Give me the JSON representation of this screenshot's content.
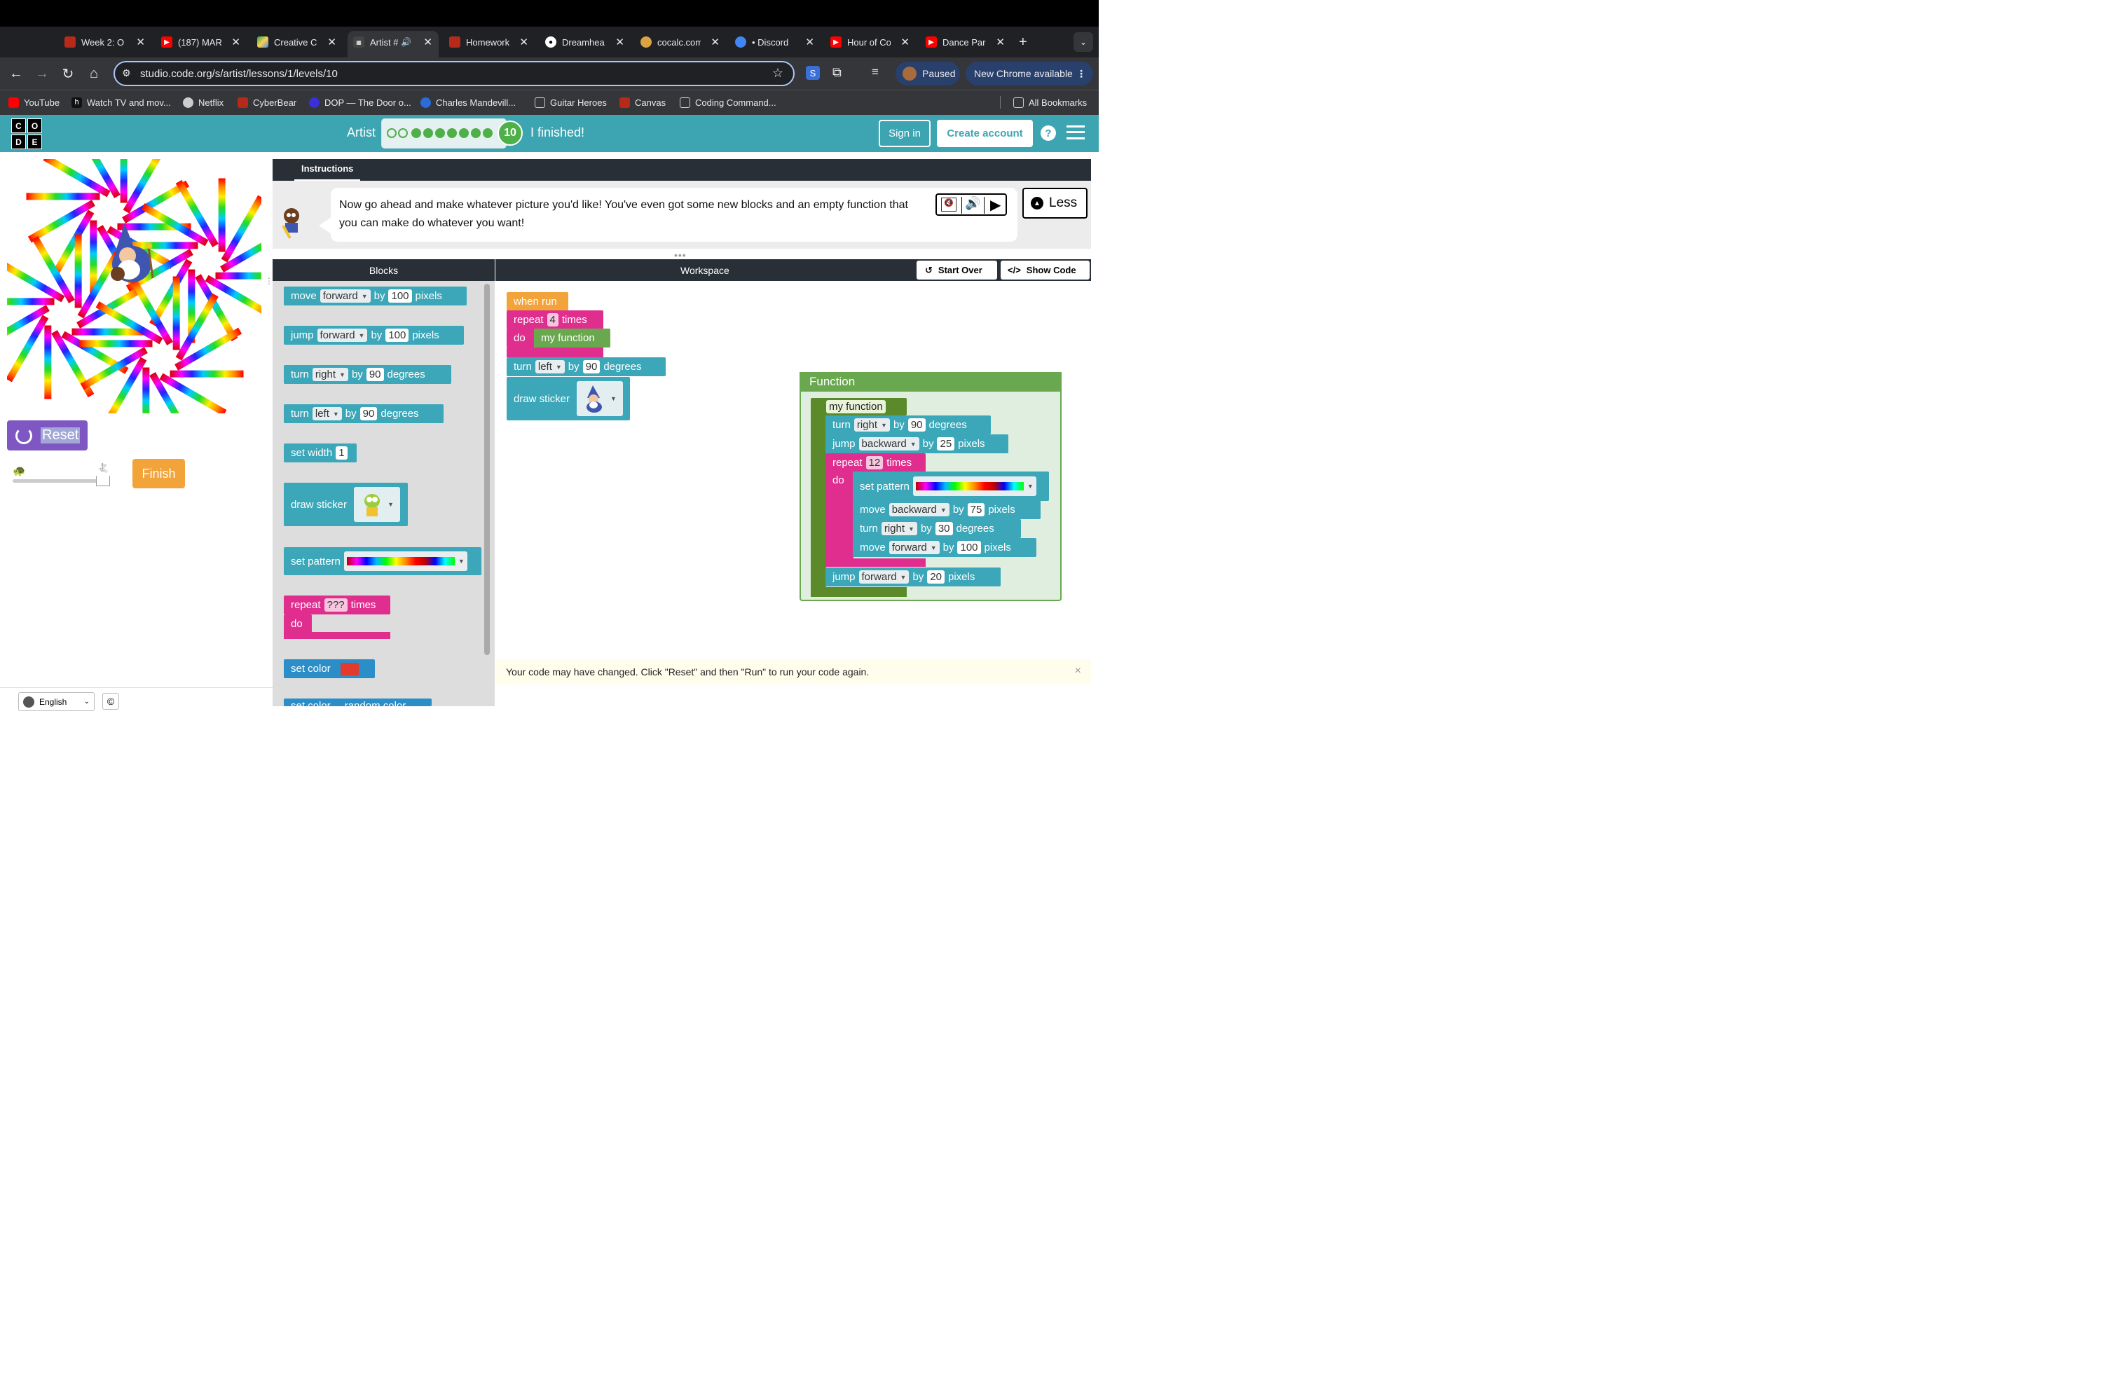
{
  "browser": {
    "tabs": [
      {
        "title": "Week 2: O",
        "icon": "canvas-icon",
        "color": "#b52a1a"
      },
      {
        "title": "(187) MAR",
        "icon": "youtube-icon",
        "color": "#ff0000"
      },
      {
        "title": "Creative C",
        "icon": "google-drive-icon",
        "color": "#1fa463"
      },
      {
        "title": "Artist #",
        "icon": "code-org-icon",
        "color": "#444444"
      },
      {
        "title": "Homework",
        "icon": "canvas-icon",
        "color": "#b52a1a"
      },
      {
        "title": "Dreamhea",
        "icon": "github-icon",
        "color": "#ffffff"
      },
      {
        "title": "cocalc.com",
        "icon": "cocalc-icon",
        "color": "#d9a441"
      },
      {
        "title": "• Discord",
        "icon": "chrome-icon",
        "color": "#4285f4"
      },
      {
        "title": "Hour of Co",
        "icon": "youtube-icon",
        "color": "#ff0000"
      },
      {
        "title": "Dance Par",
        "icon": "youtube-icon",
        "color": "#ff0000"
      }
    ],
    "url": "studio.code.org/s/artist/lessons/1/levels/10",
    "profile_label": "Paused",
    "update_label": "New Chrome available",
    "bookmarks": [
      {
        "label": "YouTube",
        "icon": "youtube-icon",
        "color": "#ff0000"
      },
      {
        "label": "Watch TV and mov...",
        "icon": "hulu-icon",
        "color": "#111111"
      },
      {
        "label": "Netflix",
        "icon": "globe-icon",
        "color": "#cccccc"
      },
      {
        "label": "CyberBear",
        "icon": "canvas-icon",
        "color": "#b52a1a"
      },
      {
        "label": "DOP — The Door o...",
        "icon": "dop-icon",
        "color": "#3b2fd6"
      },
      {
        "label": "Charles Mandevill...",
        "icon": "site-icon",
        "color": "#2b6cd6"
      },
      {
        "label": "Guitar Heroes",
        "icon": "folder-icon",
        "color": "#cccccc"
      },
      {
        "label": "Canvas",
        "icon": "canvas-icon",
        "color": "#b52a1a"
      },
      {
        "label": "Coding Command...",
        "icon": "folder-icon",
        "color": "#cccccc"
      }
    ],
    "all_bookmarks": "All Bookmarks"
  },
  "header": {
    "logo_letters": [
      "C",
      "O",
      "D",
      "E"
    ],
    "lesson_name": "Artist",
    "current_level": "10",
    "finished_text": "I finished!",
    "sign_in": "Sign in",
    "create_account": "Create account",
    "help": "?"
  },
  "left": {
    "reset": "Reset",
    "finish": "Finish",
    "language": "English",
    "copyright": "©"
  },
  "instructions": {
    "tab": "Instructions",
    "text": "Now go ahead and make whatever picture you'd like! You've even got some new blocks and an empty function that you can make do whatever you want!",
    "less": "Less"
  },
  "panels": {
    "blocks": "Blocks",
    "workspace": "Workspace",
    "start_over": "Start Over",
    "show_code": "Show Code"
  },
  "toolbox": {
    "move": [
      "move",
      "forward",
      "by",
      "100",
      "pixels"
    ],
    "jump": [
      "jump",
      "forward",
      "by",
      "100",
      "pixels"
    ],
    "turn_right": [
      "turn",
      "right",
      "by",
      "90",
      "degrees"
    ],
    "turn_left": [
      "turn",
      "left",
      "by",
      "90",
      "degrees"
    ],
    "set_width": [
      "set width",
      "1"
    ],
    "draw_sticker": "draw sticker",
    "set_pattern": "set pattern",
    "repeat": [
      "repeat",
      "???",
      "times"
    ],
    "do": "do",
    "set_color": "set color",
    "set_color_random": [
      "set color",
      "random color"
    ]
  },
  "program": {
    "when_run": "when run",
    "repeat": [
      "repeat",
      "4",
      "times"
    ],
    "do": "do",
    "call": "my function",
    "turn": [
      "turn",
      "left",
      "by",
      "90",
      "degrees"
    ],
    "draw_sticker": "draw sticker"
  },
  "function_editor": {
    "title": "Function",
    "name": "my function",
    "b1": [
      "turn",
      "right",
      "by",
      "90",
      "degrees"
    ],
    "b2": [
      "jump",
      "backward",
      "by",
      "25",
      "pixels"
    ],
    "repeat": [
      "repeat",
      "12",
      "times"
    ],
    "do": "do",
    "set_pattern": "set pattern",
    "b3": [
      "move",
      "backward",
      "by",
      "75",
      "pixels"
    ],
    "b4": [
      "turn",
      "right",
      "by",
      "30",
      "degrees"
    ],
    "b5": [
      "move",
      "forward",
      "by",
      "100",
      "pixels"
    ],
    "b6": [
      "jump",
      "forward",
      "by",
      "20",
      "pixels"
    ]
  },
  "warning": {
    "text": "Your code may have changed. Click \"Reset\" and then \"Run\" to run your code again.",
    "close": "×"
  },
  "colors": {
    "header_teal": "#3da5b2",
    "motion_block": "#3ba7b9",
    "loop_block": "#e02e8f",
    "event_block": "#f2a33a",
    "function_block": "#6aa84f",
    "reset_purple": "#7e57c2",
    "progress_green": "#4fb049"
  }
}
